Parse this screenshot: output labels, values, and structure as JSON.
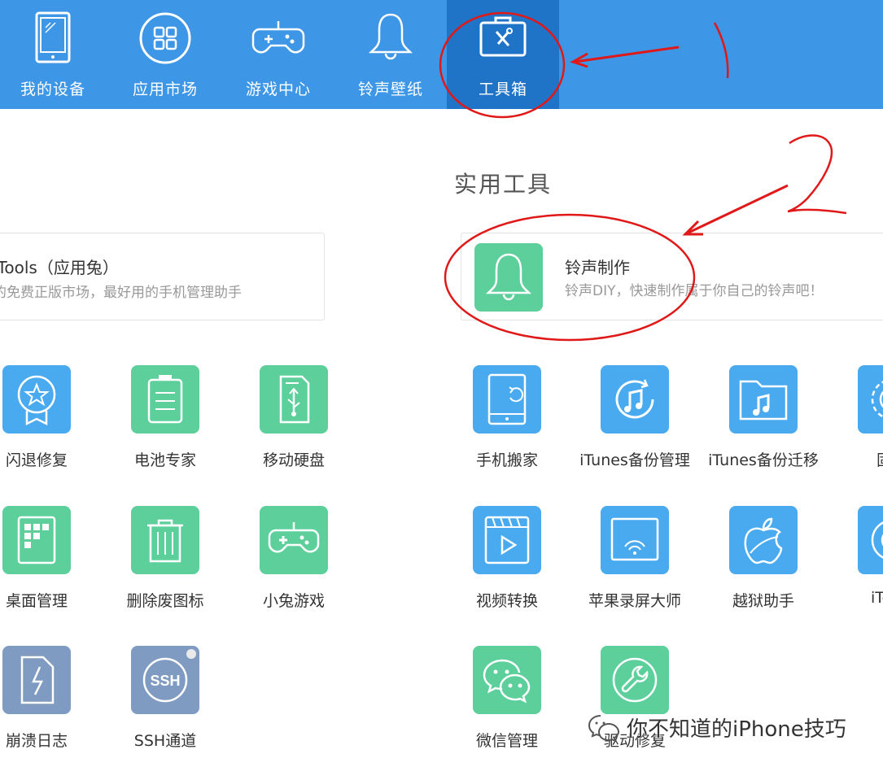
{
  "nav": {
    "items": [
      {
        "label": "我的设备",
        "icon": "tablet-icon"
      },
      {
        "label": "应用市场",
        "icon": "apps-grid-icon"
      },
      {
        "label": "游戏中心",
        "icon": "gamepad-icon"
      },
      {
        "label": "铃声壁纸",
        "icon": "bell-icon"
      },
      {
        "label": "工具箱",
        "icon": "toolbox-icon",
        "active": true
      }
    ]
  },
  "section": {
    "title": "实用工具"
  },
  "cards": {
    "left": {
      "title": "iTools（应用兔）",
      "desc": "的免费正版市场，最好用的手机管理助手",
      "title_prefix": "i"
    },
    "right": {
      "title": "铃声制作",
      "desc": "铃声DIY，快速制作属于你自己的铃声吧！",
      "icon": "bell-icon"
    }
  },
  "tools_left": [
    {
      "label": "闪退修复",
      "icon": "award-star-icon",
      "color": "blue"
    },
    {
      "label": "电池专家",
      "icon": "battery-icon",
      "color": "green"
    },
    {
      "label": "移动硬盘",
      "icon": "usb-drive-icon",
      "color": "green"
    },
    {
      "label": "桌面管理",
      "icon": "desktop-grid-icon",
      "color": "green"
    },
    {
      "label": "删除废图标",
      "icon": "trash-icon",
      "color": "green"
    },
    {
      "label": "小兔游戏",
      "icon": "gamepad-icon",
      "color": "green"
    },
    {
      "label": "崩溃日志",
      "icon": "crash-log-icon",
      "color": "slate"
    },
    {
      "label": "SSH通道",
      "icon": "ssh-icon",
      "color": "slate",
      "badge_text": "SSH"
    }
  ],
  "tools_right": [
    {
      "label": "手机搬家",
      "icon": "phone-migrate-icon",
      "color": "blue"
    },
    {
      "label": "iTunes备份管理",
      "icon": "music-sync-icon",
      "color": "blue"
    },
    {
      "label": "iTunes备份迁移",
      "icon": "music-folder-icon",
      "color": "blue"
    },
    {
      "label": "固件",
      "icon": "gear-icon",
      "color": "blue"
    },
    {
      "label": "视频转换",
      "icon": "video-icon",
      "color": "blue"
    },
    {
      "label": "苹果录屏大师",
      "icon": "screen-cast-icon",
      "color": "blue"
    },
    {
      "label": "越狱助手",
      "icon": "apple-icon",
      "color": "blue"
    },
    {
      "label": "iTools",
      "icon": "itools-icon",
      "color": "blue"
    },
    {
      "label": "微信管理",
      "icon": "wechat-icon",
      "color": "green"
    },
    {
      "label": "驱动修复",
      "icon": "wrench-icon",
      "color": "green"
    }
  ],
  "watermark": {
    "text": "你不知道的iPhone技巧",
    "icon": "wechat-logo-icon"
  },
  "colors": {
    "nav_bg": "#3d96e6",
    "nav_active": "#1f74c8",
    "tile_blue": "#4aaaf0",
    "tile_green": "#5ccf9b",
    "tile_slate": "#7f9bc2",
    "annotation_red": "#e01818"
  }
}
